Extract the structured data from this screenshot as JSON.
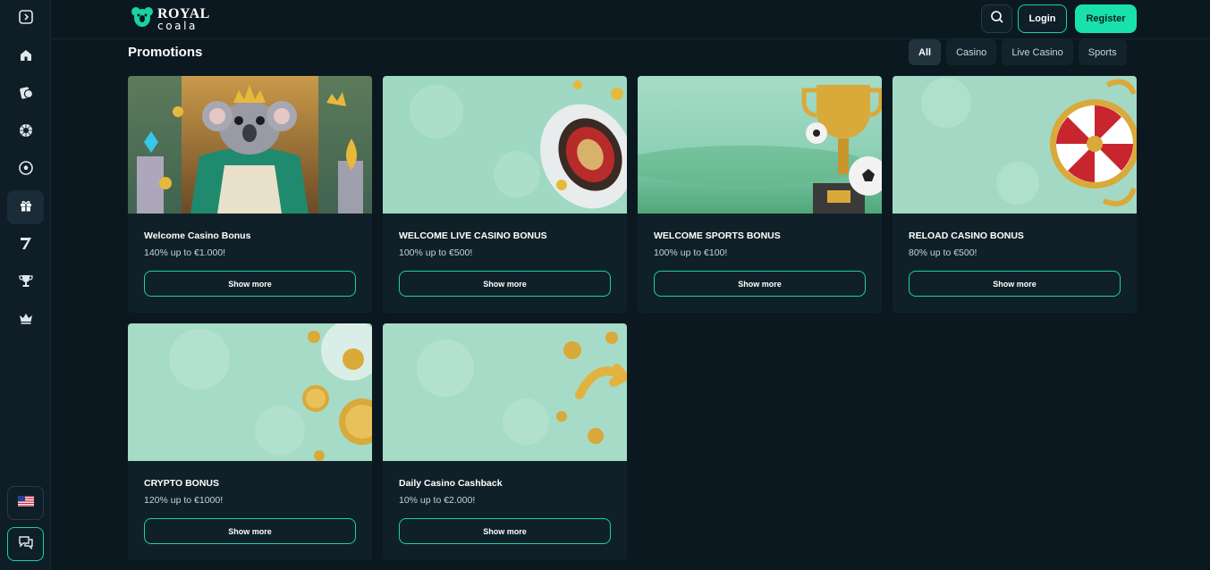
{
  "brand": {
    "logo_top": "ROYAL",
    "logo_bottom": "coala"
  },
  "header": {
    "login_label": "Login",
    "register_label": "Register"
  },
  "page": {
    "title": "Promotions"
  },
  "filters": [
    {
      "label": "All",
      "active": true
    },
    {
      "label": "Casino",
      "active": false
    },
    {
      "label": "Live Casino",
      "active": false
    },
    {
      "label": "Sports",
      "active": false
    }
  ],
  "sidebar": {
    "items": [
      {
        "icon": "collapse-icon"
      },
      {
        "icon": "home-icon"
      },
      {
        "icon": "casino-chip-icon"
      },
      {
        "icon": "roulette-icon"
      },
      {
        "icon": "soccer-ball-icon"
      },
      {
        "icon": "gift-icon",
        "active": true
      },
      {
        "icon": "seven-slot-icon"
      },
      {
        "icon": "trophy-icon"
      },
      {
        "icon": "crown-icon"
      }
    ],
    "language_icon": "us-flag-icon",
    "chat_icon": "chat-icon"
  },
  "promotions": [
    {
      "title": "Welcome Casino Bonus",
      "subtitle": "140% up to €1.000!",
      "button": "Show more"
    },
    {
      "title": "WELCOME LIVE CASINO BONUS",
      "subtitle": "100% up to €500!",
      "button": "Show more"
    },
    {
      "title": "WELCOME SPORTS BONUS",
      "subtitle": "100% up to €100!",
      "button": "Show more"
    },
    {
      "title": "RELOAD CASINO BONUS",
      "subtitle": "80% up to €500!",
      "button": "Show more"
    },
    {
      "title": "CRYPTO BONUS",
      "subtitle": "120% up to €1000!",
      "button": "Show more"
    },
    {
      "title": "Daily Casino Cashback",
      "subtitle": "10% up to €2.000!",
      "button": "Show more"
    }
  ],
  "colors": {
    "background": "#0b1820",
    "card": "#102029",
    "accent": "#19e1ad",
    "mint_image": "#a9dcc8"
  }
}
